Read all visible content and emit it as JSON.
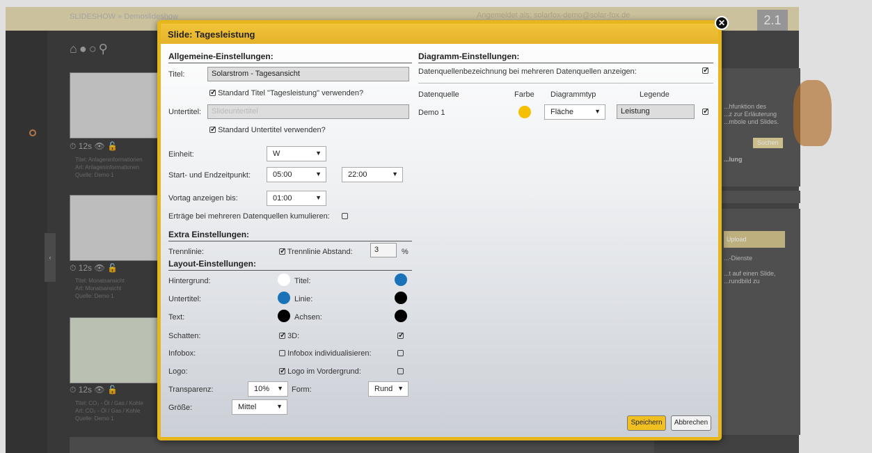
{
  "background": {
    "breadcrumb": "SLIDESHOW » Demoslideshow",
    "login_text": "Angemeldet als: solarfox-demo@solar-fox.de",
    "version": "2.1",
    "nav_icons": [
      "home-icon",
      "user-icon",
      "chat-icon",
      "search-icon",
      "play-icon"
    ],
    "slides": [
      {
        "time": "12s",
        "info": [
          "Titel: Anlageninformationen",
          "Art: Anlageninformationen",
          "Quelle: Demo 1"
        ]
      },
      {
        "time": "12s",
        "info": [
          "Titel: Monatsansicht",
          "Art: Monatsansicht",
          "Quelle: Demo 1"
        ]
      },
      {
        "time": "12s",
        "info": [
          "Titel: CO₂ - Öl / Gas / Kohle",
          "Art: CO₂ - Öl / Gas / Kohle",
          "Quelle: Demo 1"
        ]
      }
    ],
    "right_panel": {
      "help_text": [
        "...hfunktion des",
        "...z zur Erläuterung",
        "...mbole und Slides."
      ],
      "search_button": "Suchen",
      "line1": "...lung",
      "upload_label": "Upload",
      "dienste": "...-Dienste",
      "upload_hint": [
        "...t auf einen Slide,",
        "...rundbild zu"
      ]
    }
  },
  "modal": {
    "title": "Slide: Tagesleistung",
    "general": {
      "heading": "Allgemeine-Einstellungen:",
      "title_label": "Titel:",
      "title_value": "Solarstrom - Tagesansicht",
      "std_title_label": "Standard Titel \"Tagesleistung\" verwenden?",
      "std_title_checked": true,
      "subtitle_label": "Untertitel:",
      "subtitle_placeholder": "Slideuntertitel",
      "std_subtitle_label": "Standard Untertitel verwenden?",
      "std_subtitle_checked": true,
      "unit_label": "Einheit:",
      "unit_value": "W",
      "startend_label": "Start- und Endzeitpunkt:",
      "start_value": "05:00",
      "end_value": "22:00",
      "prevday_label": "Vortag anzeigen bis:",
      "prevday_value": "01:00",
      "cumulate_label": "Erträge bei mehreren Datenquellen kumulieren:",
      "cumulate_checked": false
    },
    "extra": {
      "heading": "Extra Einstellungen:",
      "divider_label": "Trennlinie:",
      "divider_distance_label": "Trennlinie Abstand:",
      "divider_checked": true,
      "divider_distance_value": "3",
      "percent": "%"
    },
    "layout": {
      "heading": "Layout-Einstellungen:",
      "background_label": "Hintergrund:",
      "background_color": "#ffffff",
      "title_label": "Titel:",
      "title_color": "#1a73b8",
      "subtitle_label": "Untertitel:",
      "subtitle_color": "#1a73b8",
      "line_label": "Linie:",
      "line_color": "#000000",
      "text_label": "Text:",
      "text_color": "#000000",
      "axes_label": "Achsen:",
      "axes_color": "#000000",
      "shadow_label": "Schatten:",
      "shadow_checked": true,
      "threed_label": "3D:",
      "threed_checked": true,
      "infobox_label": "Infobox:",
      "infobox_checked": false,
      "infobox_custom_label": "Infobox individualisieren:",
      "infobox_custom_checked": false,
      "logo_label": "Logo:",
      "logo_checked": true,
      "logo_front_label": "Logo im Vordergrund:",
      "logo_front_checked": false,
      "transparency_label": "Transparenz:",
      "transparency_value": "10%",
      "form_label": "Form:",
      "form_value": "Rund",
      "size_label": "Größe:",
      "size_value": "Mittel"
    },
    "diagram": {
      "heading": "Diagramm-Einstellungen:",
      "show_source_names_label": "Datenquellenbezeichnung bei mehreren Datenquellen anzeigen:",
      "show_source_names_checked": true,
      "columns": [
        "Datenquelle",
        "Farbe",
        "Diagrammtyp",
        "Legende"
      ],
      "rows": [
        {
          "source": "Demo 1",
          "color": "#f5c000",
          "type": "Fläche",
          "legend": "Leistung",
          "checked": true
        }
      ]
    },
    "buttons": {
      "save": "Speichern",
      "cancel": "Abbrechen"
    }
  }
}
